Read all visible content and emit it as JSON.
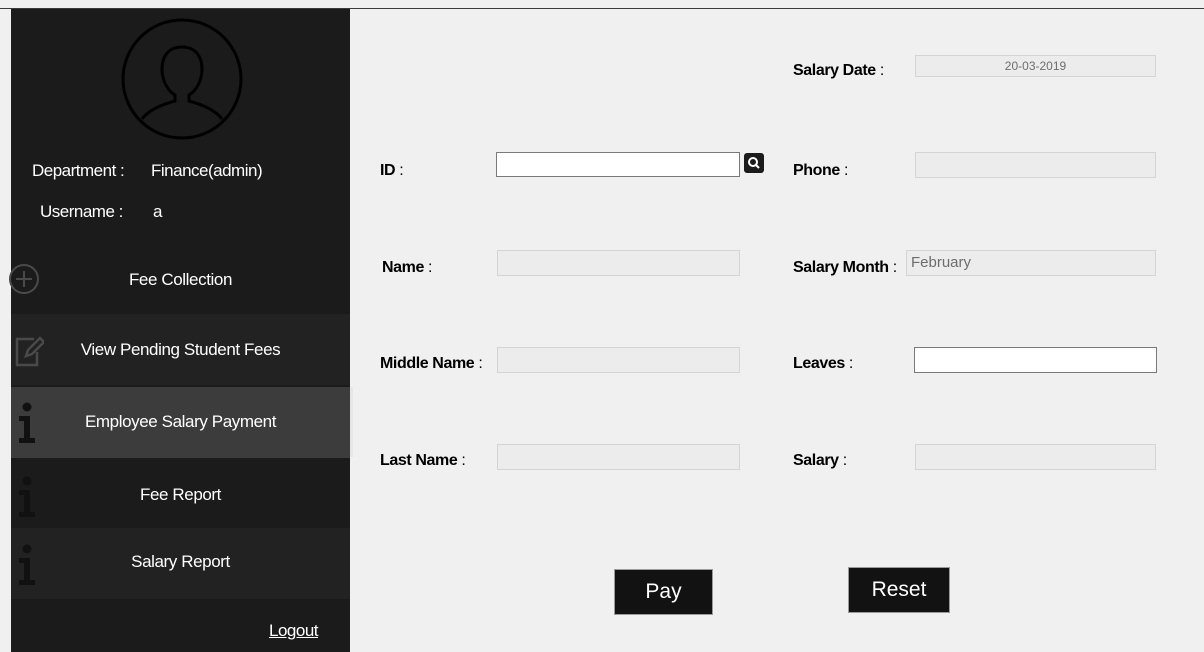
{
  "sidebar": {
    "department_label": "Department :",
    "department_value": "Finance(admin)",
    "username_label": "Username :",
    "username_value": "a",
    "items": [
      {
        "label": "Fee Collection",
        "icon": "plus-circle-icon"
      },
      {
        "label": "View Pending Student Fees",
        "icon": "edit-icon"
      },
      {
        "label": "Employee Salary Payment",
        "icon": "info-icon"
      },
      {
        "label": "Fee Report",
        "icon": "info-icon"
      },
      {
        "label": "Salary Report",
        "icon": "info-icon"
      }
    ],
    "active_item": "Employee Salary Payment",
    "logout": "Logout"
  },
  "form": {
    "salary_date": {
      "label": "Salary Date",
      "value": "20-03-2019"
    },
    "id": {
      "label": "ID",
      "value": ""
    },
    "phone": {
      "label": "Phone",
      "value": ""
    },
    "name": {
      "label": "Name",
      "value": ""
    },
    "salary_month": {
      "label": "Salary Month",
      "value": "February"
    },
    "middle_name": {
      "label": "Middle Name",
      "value": ""
    },
    "leaves": {
      "label": "Leaves",
      "value": ""
    },
    "last_name": {
      "label": "Last Name",
      "value": ""
    },
    "salary": {
      "label": "Salary",
      "value": ""
    },
    "colon": ":"
  },
  "buttons": {
    "pay": "Pay",
    "reset": "Reset"
  },
  "colors": {
    "sidebar_bg": "#1b1b1b",
    "active_item_bg": "#3c3c3c",
    "button_bg": "#121212",
    "form_bg": "#f0f0f0"
  }
}
